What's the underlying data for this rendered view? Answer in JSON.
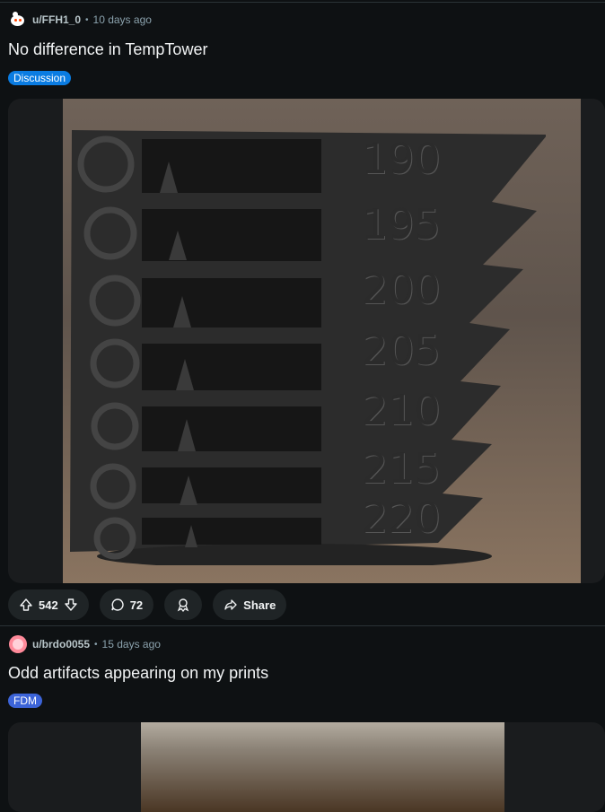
{
  "posts": [
    {
      "user": "u/FFH1_0",
      "time": "10 days ago",
      "title": "No difference in TempTower",
      "flair": "Discussion",
      "image_labels": [
        "190",
        "195",
        "200",
        "205",
        "210",
        "215",
        "220"
      ],
      "votes": "542",
      "comments": "72",
      "share_label": "Share"
    },
    {
      "user": "u/brdo0055",
      "time": "15 days ago",
      "title": "Odd artifacts appearing on my prints",
      "flair": "FDM"
    }
  ],
  "icons": [
    "upvote-icon",
    "downvote-icon",
    "comment-icon",
    "award-icon",
    "share-icon"
  ],
  "colors": {
    "background": "#0e1113",
    "flair_discussion": "#0a7ce2",
    "flair_fdm": "#3c64d8",
    "pill": "#1f2426"
  }
}
